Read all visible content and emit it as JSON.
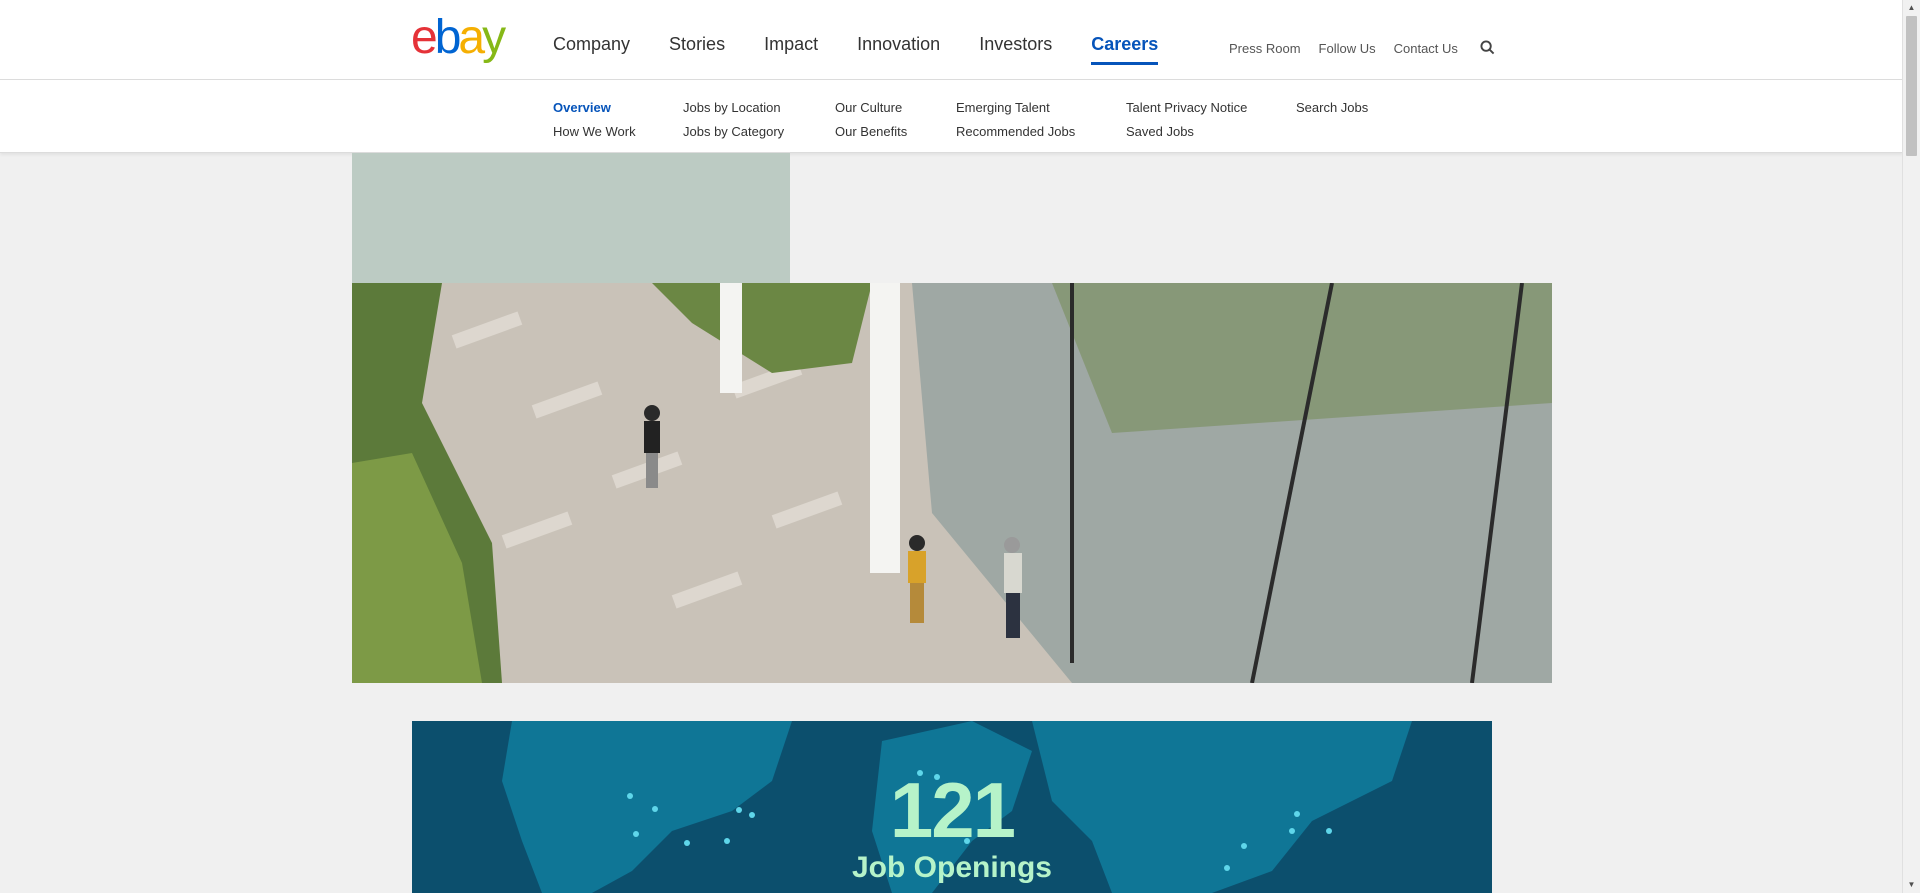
{
  "header": {
    "logo_letters": [
      "e",
      "b",
      "a",
      "y"
    ],
    "main_nav": [
      {
        "label": "Company",
        "active": false
      },
      {
        "label": "Stories",
        "active": false
      },
      {
        "label": "Impact",
        "active": false
      },
      {
        "label": "Innovation",
        "active": false
      },
      {
        "label": "Investors",
        "active": false
      },
      {
        "label": "Careers",
        "active": true
      }
    ],
    "util_nav": [
      "Press Room",
      "Follow Us",
      "Contact Us"
    ],
    "search_icon": "search-icon"
  },
  "subnav": {
    "columns": [
      [
        "Overview",
        "How We Work"
      ],
      [
        "Jobs by Location",
        "Jobs by Category"
      ],
      [
        "Our Culture",
        "Our Benefits"
      ],
      [
        "Emerging Talent",
        "Recommended Jobs"
      ],
      [
        "Talent Privacy Notice",
        "Saved Jobs"
      ],
      [
        "Search Jobs"
      ]
    ],
    "active": "Overview"
  },
  "jobs_banner": {
    "count": "121",
    "label": "Job Openings"
  },
  "colors": {
    "accent": "#0654ba",
    "banner": "#0c4f6d",
    "banner_text": "#b6f3c9",
    "green_block": "#bccbc3"
  }
}
